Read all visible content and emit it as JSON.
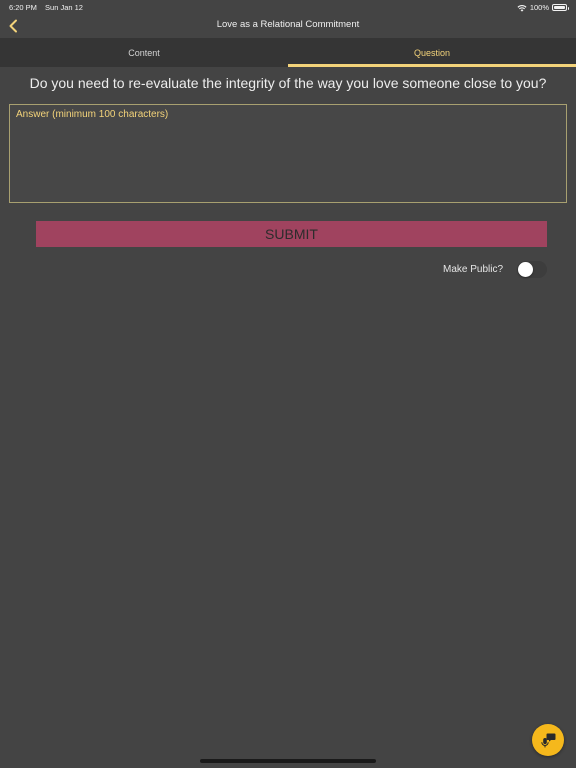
{
  "status_bar": {
    "time": "6:20 PM",
    "date": "Sun Jan 12",
    "battery": "100%"
  },
  "nav": {
    "title": "Love as a Relational Commitment"
  },
  "tabs": [
    {
      "label": "Content",
      "active": false
    },
    {
      "label": "Question",
      "active": true
    }
  ],
  "question": {
    "text": "Do you need to re-evaluate the integrity of the way you love someone close to you?"
  },
  "answer": {
    "placeholder": "Answer (minimum 100 characters)",
    "value": ""
  },
  "submit": {
    "label": "SUBMIT"
  },
  "make_public": {
    "label": "Make Public?",
    "enabled": false
  },
  "colors": {
    "background": "#444444",
    "tab_bar": "#353535",
    "accent": "#f3d37a",
    "submit": "#a0435f",
    "fab": "#f5b81c"
  },
  "icons": {
    "back": "chevron-left-icon",
    "wifi": "wifi-icon",
    "battery": "battery-icon",
    "fab": "microphone-chat-icon"
  }
}
